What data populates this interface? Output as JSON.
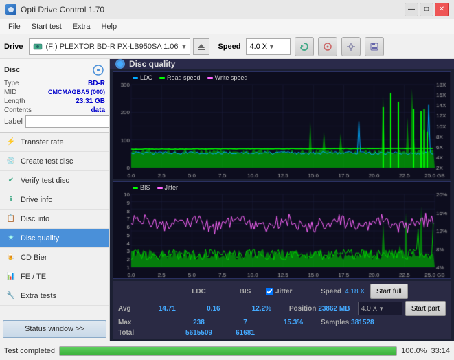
{
  "app": {
    "title": "Opti Drive Control 1.70",
    "icon": "disc-icon"
  },
  "titlebar": {
    "title": "Opti Drive Control 1.70",
    "minimize_label": "—",
    "maximize_label": "□",
    "close_label": "✕"
  },
  "menubar": {
    "items": [
      "File",
      "Start test",
      "Extra",
      "Help"
    ]
  },
  "toolbar": {
    "drive_label": "Drive",
    "drive_text": "(F:) PLEXTOR BD-R  PX-LB950SA 1.06",
    "speed_label": "Speed",
    "speed_value": "4.0 X"
  },
  "disc": {
    "section_title": "Disc",
    "type_label": "Type",
    "type_val": "BD-R",
    "mid_label": "MID",
    "mid_val": "CMCMAGBA5 (000)",
    "length_label": "Length",
    "length_val": "23.31 GB",
    "contents_label": "Contents",
    "contents_val": "data",
    "label_label": "Label",
    "label_val": ""
  },
  "nav": {
    "items": [
      {
        "id": "transfer-rate",
        "label": "Transfer rate",
        "icon": "⚡"
      },
      {
        "id": "create-test-disc",
        "label": "Create test disc",
        "icon": "💿"
      },
      {
        "id": "verify-test-disc",
        "label": "Verify test disc",
        "icon": "✔"
      },
      {
        "id": "drive-info",
        "label": "Drive info",
        "icon": "ℹ"
      },
      {
        "id": "disc-info",
        "label": "Disc info",
        "icon": "📋"
      },
      {
        "id": "disc-quality",
        "label": "Disc quality",
        "icon": "★",
        "active": true
      },
      {
        "id": "cd-bier",
        "label": "CD Bier",
        "icon": "🍺"
      },
      {
        "id": "fe-te",
        "label": "FE / TE",
        "icon": "📊"
      },
      {
        "id": "extra-tests",
        "label": "Extra tests",
        "icon": "🔧"
      }
    ],
    "status_btn": "Status window >>"
  },
  "chart": {
    "title": "Disc quality",
    "upper": {
      "legend": [
        {
          "label": "LDC",
          "color": "#00aaff"
        },
        {
          "label": "Read speed",
          "color": "#00ff00"
        },
        {
          "label": "Write speed",
          "color": "#ff66ff"
        }
      ],
      "y_left": [
        "300",
        "200",
        "100",
        "0"
      ],
      "y_right": [
        "18X",
        "16X",
        "14X",
        "12X",
        "10X",
        "8X",
        "6X",
        "4X",
        "2X"
      ],
      "x_labels": [
        "0.0",
        "2.5",
        "5.0",
        "7.5",
        "10.0",
        "12.5",
        "15.0",
        "17.5",
        "20.0",
        "22.5",
        "25.0 GB"
      ]
    },
    "lower": {
      "legend": [
        {
          "label": "BIS",
          "color": "#00ff00"
        },
        {
          "label": "Jitter",
          "color": "#ff66ff"
        }
      ],
      "y_left": [
        "10",
        "9",
        "8",
        "7",
        "6",
        "5",
        "4",
        "3",
        "2",
        "1"
      ],
      "y_right": [
        "20%",
        "16%",
        "12%",
        "8%",
        "4%"
      ],
      "x_labels": [
        "0.0",
        "2.5",
        "5.0",
        "7.5",
        "10.0",
        "12.5",
        "15.0",
        "17.5",
        "20.0",
        "22.5",
        "25.0 GB"
      ]
    }
  },
  "stats": {
    "ldc_label": "LDC",
    "bis_label": "BIS",
    "jitter_checkbox": true,
    "jitter_label": "Jitter",
    "speed_label": "Speed",
    "position_label": "Position",
    "samples_label": "Samples",
    "avg_label": "Avg",
    "ldc_avg": "14.71",
    "bis_avg": "0.16",
    "jitter_avg": "12.2%",
    "max_label": "Max",
    "ldc_max": "238",
    "bis_max": "7",
    "jitter_max": "15.3%",
    "total_label": "Total",
    "ldc_total": "5615509",
    "bis_total": "61681",
    "speed_val": "4.18 X",
    "speed_select": "4.0 X",
    "position_val": "23862 MB",
    "samples_val": "381528",
    "start_full_label": "Start full",
    "start_part_label": "Start part"
  },
  "statusbar": {
    "status_text": "Test completed",
    "progress": 100,
    "progress_text": "100.0%",
    "time_text": "33:14"
  }
}
